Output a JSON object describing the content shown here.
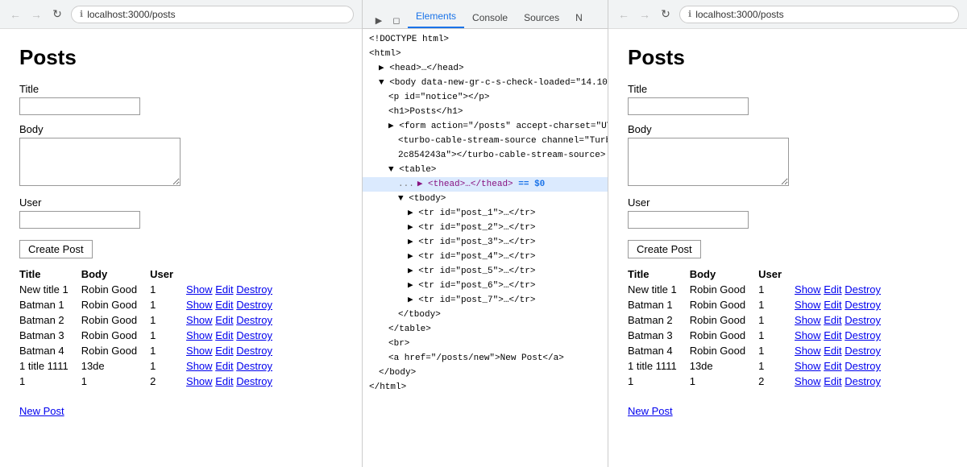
{
  "browser": {
    "url": "localhost:3000/posts",
    "url_icon": "ℹ"
  },
  "devtools": {
    "tabs": [
      "Elements",
      "Console",
      "Sources",
      "N"
    ],
    "active_tab": "Elements"
  },
  "posts_page": {
    "title": "Posts",
    "form": {
      "title_label": "Title",
      "body_label": "Body",
      "user_label": "User",
      "submit_label": "Create Post"
    },
    "table_headers": [
      "Title",
      "Body",
      "User"
    ],
    "rows": [
      {
        "title": "New title 1",
        "body": "Robin Good",
        "user": "1",
        "actions": [
          "Show",
          "Edit",
          "Destroy"
        ]
      },
      {
        "title": "Batman 1",
        "body": "Robin Good",
        "user": "1",
        "actions": [
          "Show",
          "Edit",
          "Destroy"
        ]
      },
      {
        "title": "Batman 2",
        "body": "Robin Good",
        "user": "1",
        "actions": [
          "Show",
          "Edit",
          "Destroy"
        ]
      },
      {
        "title": "Batman 3",
        "body": "Robin Good",
        "user": "1",
        "actions": [
          "Show",
          "Edit",
          "Destroy"
        ]
      },
      {
        "title": "Batman 4",
        "body": "Robin Good",
        "user": "1",
        "actions": [
          "Show",
          "Edit",
          "Destroy"
        ]
      },
      {
        "title": "1 title 1111",
        "body": "13de",
        "user": "1",
        "actions": [
          "Show",
          "Edit",
          "Destroy"
        ]
      },
      {
        "title": "1",
        "body": "1",
        "user": "2",
        "actions": [
          "Show",
          "Edit",
          "Destroy"
        ]
      }
    ],
    "new_post_link": "New Post"
  },
  "devtools_html": [
    {
      "indent": 0,
      "text": "<!DOCTYPE html>"
    },
    {
      "indent": 0,
      "text": "<html>"
    },
    {
      "indent": 1,
      "text": "▶ <head>…</head>",
      "expandable": true
    },
    {
      "indent": 1,
      "text": "▼ <body data-new-gr-c-s-check-loaded=\"14.10…",
      "expandable": true
    },
    {
      "indent": 2,
      "text": "<p id=\"notice\"></p>"
    },
    {
      "indent": 2,
      "text": "<h1>Posts</h1>"
    },
    {
      "indent": 2,
      "text": "▶ <form action=\"/posts\" accept-charset=\"UT…",
      "expandable": true
    },
    {
      "indent": 3,
      "text": "<turbo-cable-stream-source channel=\"Turb…"
    },
    {
      "indent": 3,
      "text": "2c854243a\"></turbo-cable-stream-source>"
    },
    {
      "indent": 2,
      "text": "▼ <table>",
      "expandable": true
    },
    {
      "indent": 3,
      "text": "▶ <thead>…</thead>  == $0",
      "expandable": true,
      "selected": true
    },
    {
      "indent": 3,
      "text": "▼ <tbody>",
      "expandable": true
    },
    {
      "indent": 4,
      "text": "▶ <tr id=\"post_1\">…</tr>",
      "expandable": true
    },
    {
      "indent": 4,
      "text": "▶ <tr id=\"post_2\">…</tr>",
      "expandable": true
    },
    {
      "indent": 4,
      "text": "▶ <tr id=\"post_3\">…</tr>",
      "expandable": true
    },
    {
      "indent": 4,
      "text": "▶ <tr id=\"post_4\">…</tr>",
      "expandable": true
    },
    {
      "indent": 4,
      "text": "▶ <tr id=\"post_5\">…</tr>",
      "expandable": true
    },
    {
      "indent": 4,
      "text": "▶ <tr id=\"post_6\">…</tr>",
      "expandable": true
    },
    {
      "indent": 4,
      "text": "▶ <tr id=\"post_7\">…</tr>",
      "expandable": true
    },
    {
      "indent": 3,
      "text": "</tbody>"
    },
    {
      "indent": 2,
      "text": "</table>"
    },
    {
      "indent": 2,
      "text": "<br>"
    },
    {
      "indent": 2,
      "text": "<a href=\"/posts/new\">New Post</a>"
    },
    {
      "indent": 1,
      "text": "</body>"
    },
    {
      "indent": 0,
      "text": "</html>"
    }
  ],
  "indent_classes": [
    "",
    "indent1",
    "indent2",
    "indent3",
    "indent4",
    "indent5",
    "indent6"
  ]
}
